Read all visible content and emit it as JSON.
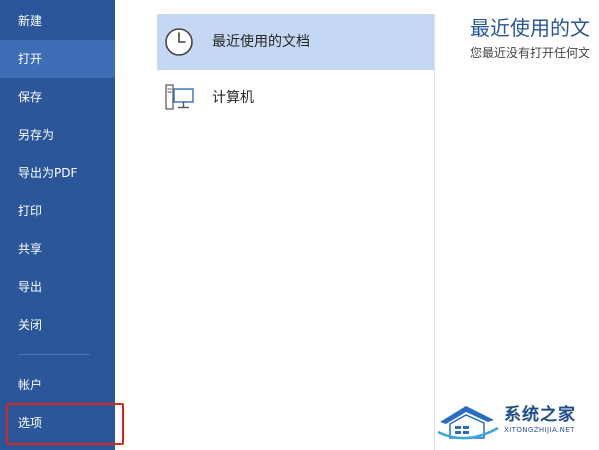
{
  "sidebar": {
    "items": [
      {
        "label": "新建"
      },
      {
        "label": "打开"
      },
      {
        "label": "保存"
      },
      {
        "label": "另存为"
      },
      {
        "label": "导出为PDF"
      },
      {
        "label": "打印"
      },
      {
        "label": "共享"
      },
      {
        "label": "导出"
      },
      {
        "label": "关闭"
      },
      {
        "label": "帐户"
      },
      {
        "label": "选项"
      }
    ]
  },
  "places": {
    "recent": {
      "label": "最近使用的文档",
      "icon": "clock-icon"
    },
    "computer": {
      "label": "计算机",
      "icon": "computer-icon"
    }
  },
  "panel": {
    "title": "最近使用的文",
    "subtitle": "您最近没有打开任何文"
  },
  "watermark": {
    "name": "系统之家",
    "url": "XITONGZHIJIA.NET"
  },
  "colors": {
    "sidebar": "#2b579a",
    "active_item": "#3d6db5",
    "selected_place": "#c5d8f3",
    "highlight": "#d9261c"
  }
}
